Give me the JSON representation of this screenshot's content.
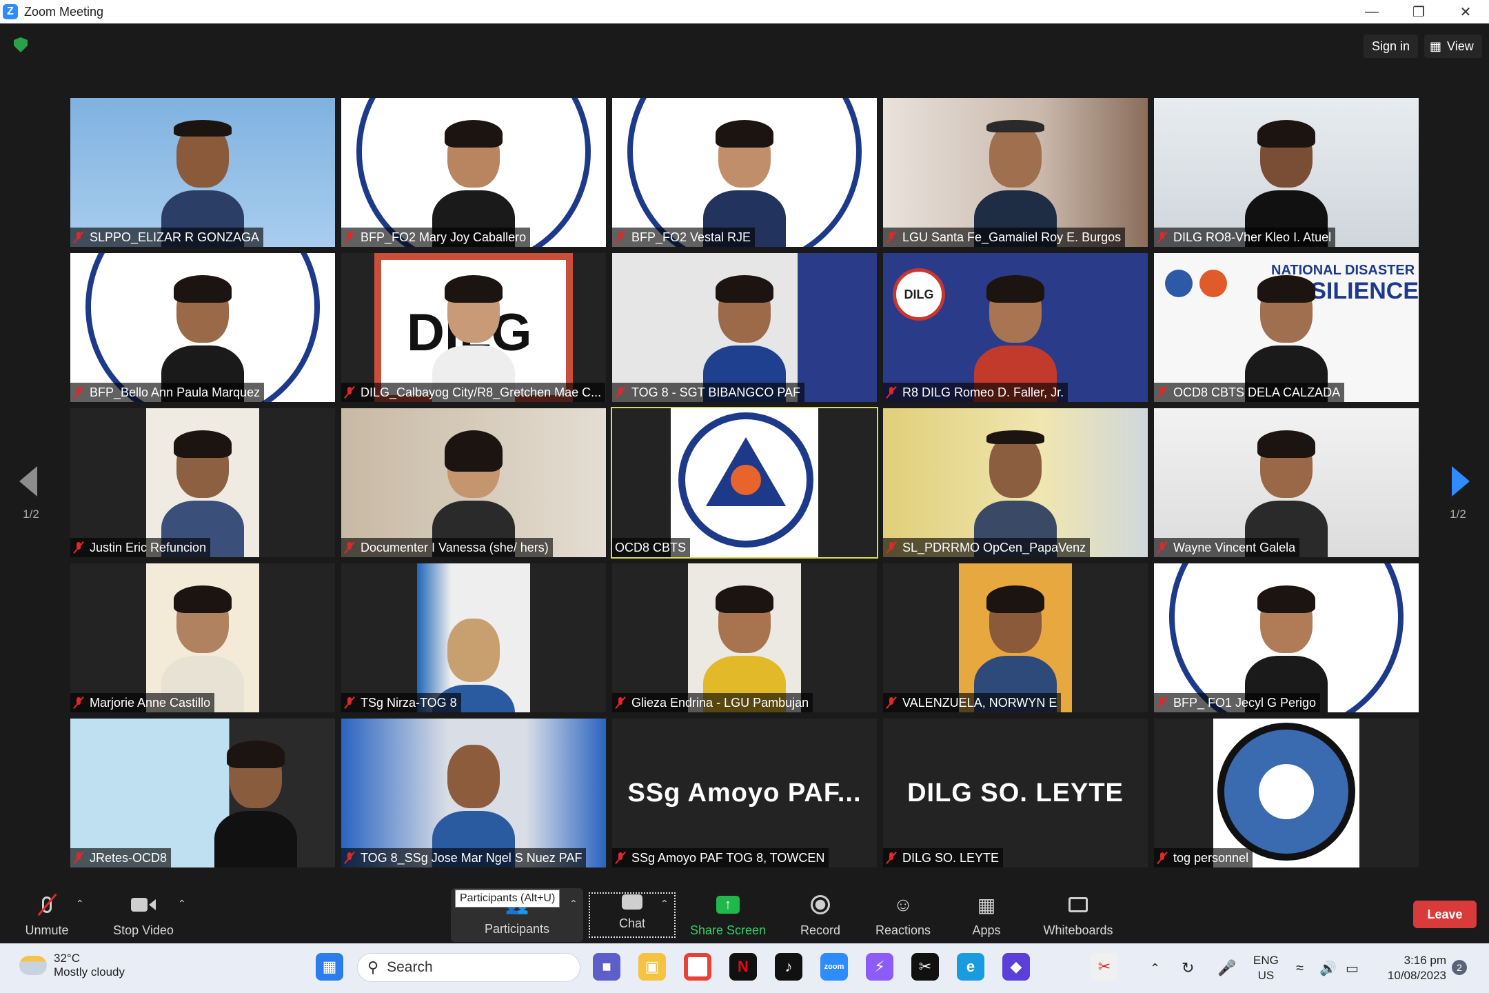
{
  "window": {
    "title": "Zoom Meeting"
  },
  "topbar": {
    "sign_in": "Sign in",
    "view": "View"
  },
  "pager": {
    "left": "1/2",
    "right": "1/2"
  },
  "tiles": [
    {
      "name": "SLPPO_ELIZAR R GONZAGA"
    },
    {
      "name": "BFP_FO2 Mary Joy Caballero"
    },
    {
      "name": "BFP_FO2 Vestal RJE"
    },
    {
      "name": "LGU Santa Fe_Gamaliel Roy E. Burgos"
    },
    {
      "name": "DILG RO8-Vher Kleo I. Atuel"
    },
    {
      "name": "BFP_Bello Ann Paula Marquez"
    },
    {
      "name": "DILG_Calbayog City/R8_Gretchen Mae C..."
    },
    {
      "name": "TOG 8 - SGT BIBANGCO PAF"
    },
    {
      "name": "R8 DILG Romeo D. Faller, Jr."
    },
    {
      "name": "OCD8 CBTS DELA CALZADA"
    },
    {
      "name": "Justin Eric Refuncion"
    },
    {
      "name": "Documenter I Vanessa (she/ hers)"
    },
    {
      "name": "OCD8 CBTS"
    },
    {
      "name": "SL_PDRRMO OpCen_PapaVenz"
    },
    {
      "name": "Wayne Vincent Galela"
    },
    {
      "name": "Marjorie Anne Castillo"
    },
    {
      "name": "TSg Nirza-TOG 8"
    },
    {
      "name": "Glieza Endrina - LGU Pambujan"
    },
    {
      "name": "VALENZUELA, NORWYN E"
    },
    {
      "name": "BFP_ FO1 Jecyl G Perigo"
    },
    {
      "name": "JRetes-OCD8"
    },
    {
      "name": "TOG 8_SSg Jose Mar Ngel S Nuez PAF"
    },
    {
      "name": "SSg Amoyo PAF TOG 8, TOWCEN",
      "big": "SSg Amoyo PAF..."
    },
    {
      "name": "DILG SO. LEYTE",
      "big": "DILG SO. LEYTE"
    },
    {
      "name": "tog personnel"
    }
  ],
  "logo_text": {
    "ndrrmc": "NATIONAL DISASTER",
    "ndrrmc2": "RESILIENCE",
    "dilg": "DILG"
  },
  "toolbar": {
    "unmute": "Unmute",
    "stop_video": "Stop Video",
    "participants": "Participants",
    "participants_count": "",
    "chat": "Chat",
    "share_screen": "Share Screen",
    "record": "Record",
    "reactions": "Reactions",
    "apps": "Apps",
    "whiteboards": "Whiteboards",
    "leave": "Leave",
    "tooltip": "Participants (Alt+U)"
  },
  "taskbar": {
    "temp": "32°C",
    "condition": "Mostly cloudy",
    "search": "Search",
    "lang1": "ENG",
    "lang2": "US",
    "time": "3:16 pm",
    "date": "10/08/2023",
    "notif_count": "2"
  },
  "colors": {
    "accent": "#2d8cff",
    "leave": "#d93a3a",
    "active_border": "#d8e04a",
    "share_green": "#1fb84a"
  }
}
